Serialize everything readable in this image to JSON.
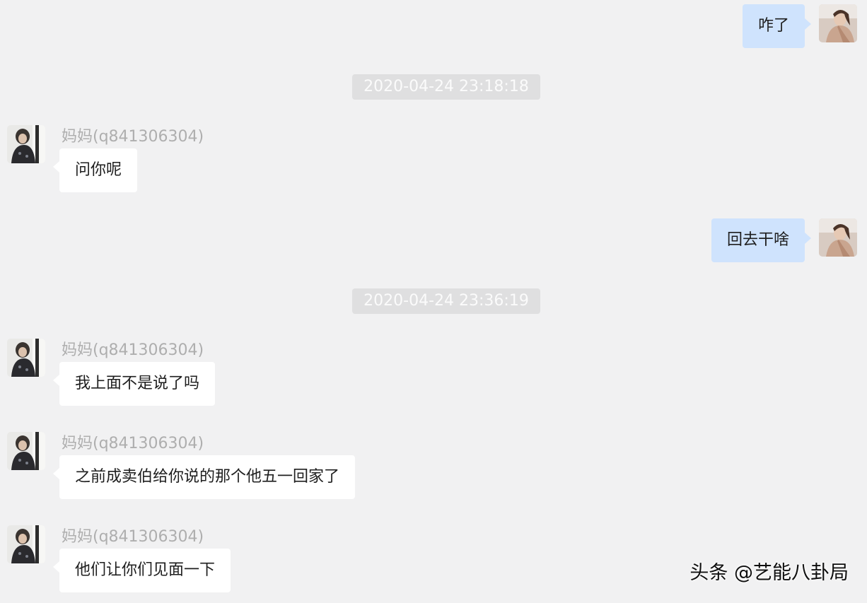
{
  "chat": {
    "messages": [
      {
        "direction": "out",
        "text": "咋了"
      },
      {
        "kind": "timestamp",
        "text": "2020-04-24 23:18:18"
      },
      {
        "direction": "in",
        "sender": "妈妈(q841306304)",
        "text": "问你呢"
      },
      {
        "direction": "out",
        "text": "回去干啥"
      },
      {
        "kind": "timestamp",
        "text": "2020-04-24 23:36:19"
      },
      {
        "direction": "in",
        "sender": "妈妈(q841306304)",
        "text": "我上面不是说了吗"
      },
      {
        "direction": "in",
        "sender": "妈妈(q841306304)",
        "text": "之前成卖伯给你说的那个他五一回家了"
      },
      {
        "direction": "in",
        "sender": "妈妈(q841306304)",
        "text": "他们让你们见面一下"
      }
    ]
  },
  "watermark": "头条 @艺能八卦局",
  "colors": {
    "background": "#f1f1f2",
    "outgoing_bubble": "#cfe3fd",
    "incoming_bubble": "#ffffff",
    "timestamp_bg": "#dfdfe0",
    "sender_text": "#aeaeae"
  }
}
